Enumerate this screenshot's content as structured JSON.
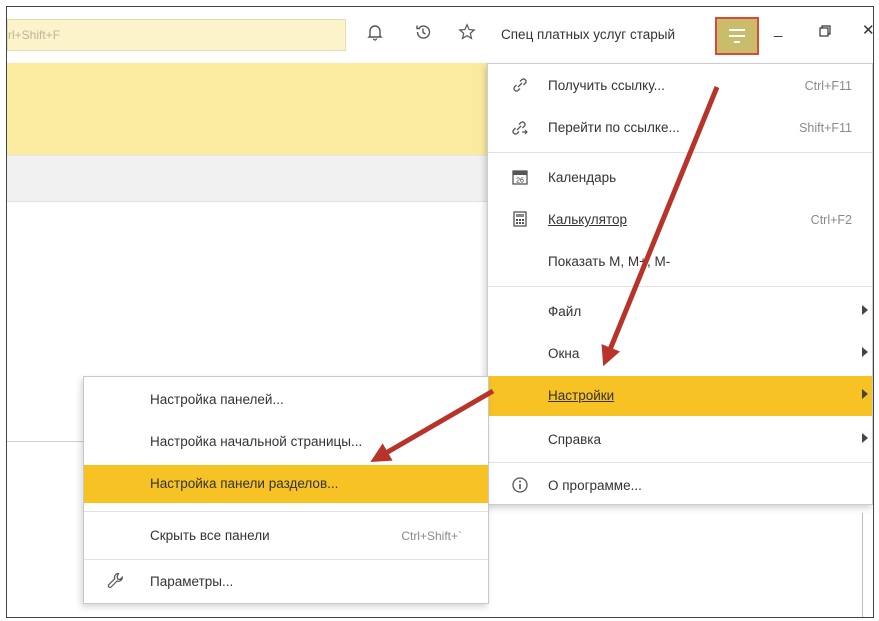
{
  "topbar": {
    "search_placeholder": "rl+Shift+F",
    "icons": [
      "bell-icon",
      "history-icon",
      "star-icon"
    ],
    "user_name": "Спец платных услуг старый",
    "menu_icon": "hamburger-menu-icon",
    "minimize_label": "_",
    "restore_label": "🗗",
    "close_label": "✕"
  },
  "dropdown": {
    "items": [
      {
        "label": "Получить ссылку...",
        "shortcut": "Ctrl+F11",
        "icon": "link-icon"
      },
      {
        "label": "Перейти по ссылке...",
        "shortcut": "Shift+F11",
        "icon": "follow-link-icon"
      },
      {
        "label": "Календарь",
        "shortcut": "",
        "icon": "calendar-icon",
        "icon_text": "26"
      },
      {
        "label": "Калькулятор",
        "shortcut": "Ctrl+F2",
        "icon": "calculator-icon"
      },
      {
        "label": "Показать М, М+, М-",
        "shortcut": "",
        "icon": ""
      },
      {
        "label": "Файл",
        "submenu": true
      },
      {
        "label": "Окна",
        "submenu": true
      },
      {
        "label": "Настройки",
        "submenu": true,
        "highlighted": true
      },
      {
        "label": "Справка",
        "submenu": true
      },
      {
        "label": "О программе...",
        "icon": "info-icon"
      }
    ]
  },
  "submenu": {
    "items": [
      {
        "label": "Настройка панелей...",
        "shortcut": ""
      },
      {
        "label": "Настройка начальной страницы...",
        "shortcut": ""
      },
      {
        "label": "Настройка панели разделов...",
        "shortcut": "",
        "highlighted": true
      },
      {
        "label": "Скрыть все панели",
        "shortcut": "Ctrl+Shift+`"
      },
      {
        "label": "Параметры...",
        "shortcut": "",
        "icon": "wrench-icon"
      }
    ]
  },
  "colors": {
    "highlight": "#f6c224",
    "yellow_band": "#fbeba0",
    "annotation_red": "#c0392b"
  }
}
